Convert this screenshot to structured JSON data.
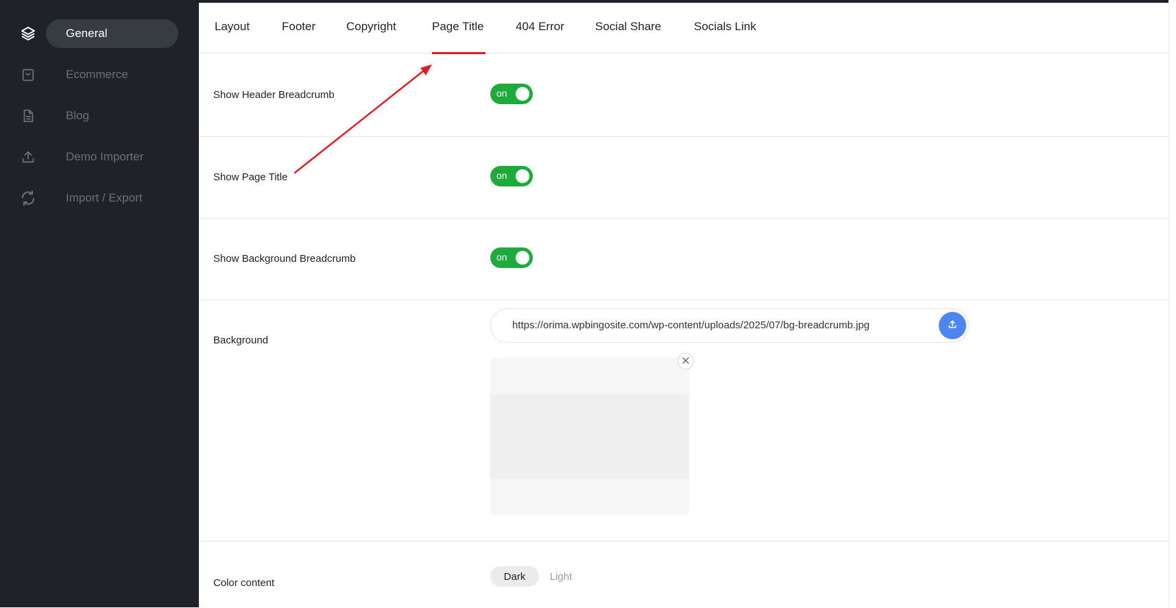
{
  "sidebar": {
    "items": [
      {
        "label": "General",
        "icon": "layers-icon",
        "active": true
      },
      {
        "label": "Ecommerce",
        "icon": "shopping-bag-icon",
        "active": false
      },
      {
        "label": "Blog",
        "icon": "document-icon",
        "active": false
      },
      {
        "label": "Demo Importer",
        "icon": "upload-icon",
        "active": false
      },
      {
        "label": "Import / Export",
        "icon": "refresh-icon",
        "active": false
      }
    ]
  },
  "tabs": [
    {
      "label": "Layout"
    },
    {
      "label": "Footer"
    },
    {
      "label": "Copyright"
    },
    {
      "label": "Page Title",
      "active": true
    },
    {
      "label": "404 Error"
    },
    {
      "label": "Social Share"
    },
    {
      "label": "Socials Link"
    }
  ],
  "settings": {
    "header_breadcrumb": {
      "label": "Show Header Breadcrumb",
      "state": "on"
    },
    "page_title": {
      "label": "Show Page Title",
      "state": "on"
    },
    "background_breadcrumb": {
      "label": "Show Background Breadcrumb",
      "state": "on"
    },
    "background": {
      "label": "Background",
      "url": "https://orima.wpbingosite.com/wp-content/uploads/2025/07/bg-breadcrumb.jpg"
    },
    "color_content": {
      "label": "Color content",
      "options": [
        "Dark",
        "Light"
      ],
      "selected": "Dark"
    }
  },
  "colors": {
    "sidebar_bg": "#1f2329",
    "toggle_on": "#1faa3c",
    "tab_active_underline": "#e21c24",
    "upload_button": "#4d86f0",
    "annotation_arrow": "#e21c24"
  }
}
